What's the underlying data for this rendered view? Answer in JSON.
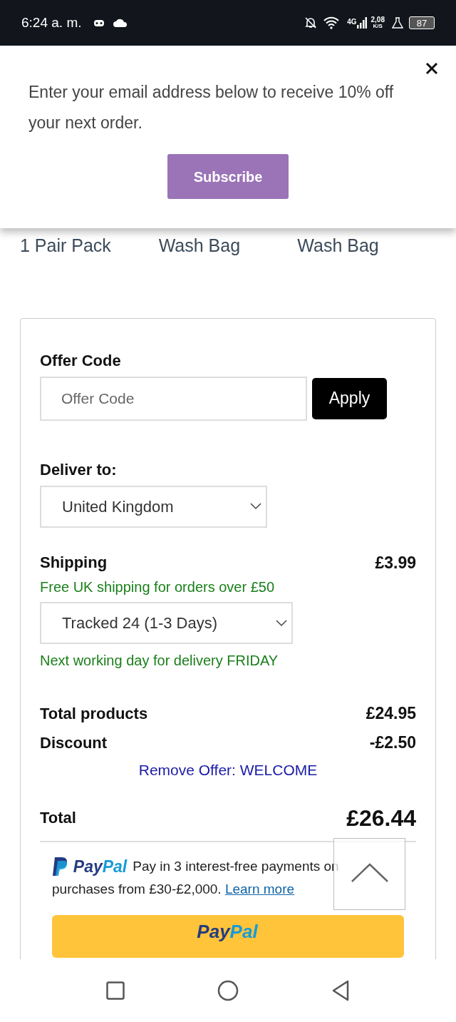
{
  "status_bar": {
    "time": "6:24 a. m.",
    "network": "4G",
    "speed": "2,08",
    "speed_unit": "K/S",
    "battery": "87"
  },
  "popup": {
    "message": "Enter your email address below to receive 10% off your next order.",
    "button": "Subscribe"
  },
  "products": [
    "1 Pair Pack",
    "Wash Bag",
    "Wash Bag"
  ],
  "offer": {
    "label": "Offer Code",
    "placeholder": "Offer Code",
    "button": "Apply"
  },
  "delivery": {
    "label": "Deliver to:",
    "value": "United Kingdom"
  },
  "shipping": {
    "label": "Shipping",
    "price": "£3.99",
    "note": "Free UK shipping for orders over £50",
    "method": "Tracked 24 (1-3 Days)",
    "next_day": "Next working day for delivery FRIDAY"
  },
  "summary": [
    {
      "label": "Total products",
      "value": "£24.95"
    },
    {
      "label": "Discount",
      "value": "-£2.50"
    }
  ],
  "remove_offer": "Remove Offer: WELCOME",
  "total": {
    "label": "Total",
    "value": "£26.44"
  },
  "paypal": {
    "logo_pay": "Pay",
    "logo_pal": "Pal",
    "message": "Pay in 3 interest-free payments on purchases from £30-£2,000.",
    "link": "Learn more"
  },
  "paypal_button": {
    "pay": "Pay",
    "pal": "Pal"
  }
}
